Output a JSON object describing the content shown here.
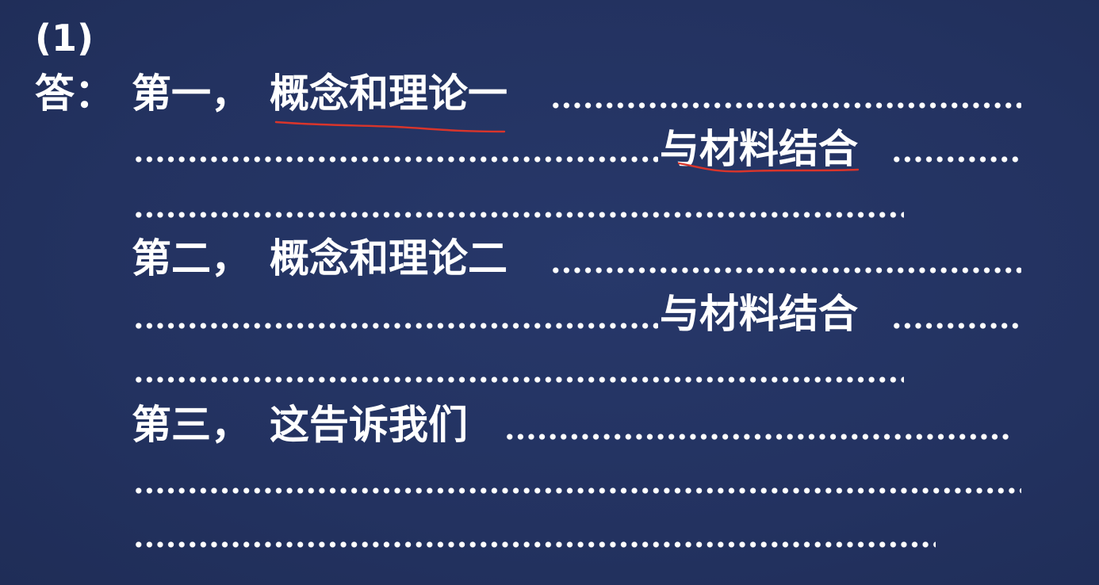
{
  "question_number": "(1)",
  "answer_prefix": "答：",
  "points": [
    {
      "lead": "第一，",
      "concept": "概念和理论一",
      "combine": "与材料结合"
    },
    {
      "lead": "第二，",
      "concept": "概念和理论二",
      "combine": "与材料结合"
    },
    {
      "lead": "第三，",
      "concept": "这告诉我们"
    }
  ],
  "colors": {
    "background": "#243460",
    "text": "#ffffff",
    "annotation": "#d9352b"
  }
}
